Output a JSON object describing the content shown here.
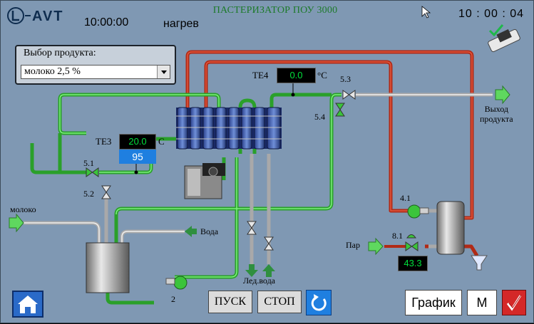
{
  "header": {
    "brand": "L-AVT",
    "title": "ПАСТЕРИЗАТОР ПОУ 3000",
    "time": "10:00:00",
    "mode": "нагрев",
    "clock": "10 : 00 : 04"
  },
  "product": {
    "label": "Выбор продукта:",
    "selected": "молоко 2,5 %"
  },
  "sensors": {
    "te4": {
      "label": "TE4",
      "value": "0.0",
      "unit": "°C"
    },
    "te3": {
      "label": "TE3",
      "value": "20.0",
      "unit": "C",
      "setpoint": "95"
    },
    "steam_value": "43.3"
  },
  "valves": {
    "v51": "5.1",
    "v52": "5.2",
    "v53": "5.3",
    "v54": "5.4",
    "pump41": "4.1",
    "v81": "8.1",
    "pump2": "2"
  },
  "labels": {
    "milk_in": "молоко",
    "water": "Вода",
    "ice_water": "Лед.вода",
    "steam": "Пар",
    "product_out": "Выход\nпродукта"
  },
  "buttons": {
    "start": "ПУСК",
    "stop": "СТОП",
    "graph": "График",
    "m": "M"
  },
  "colors": {
    "background": "#7f98b3",
    "product_pipe": "#3bc43b",
    "hot_pipe": "#c8321e",
    "cold_pipe": "#d9d9d9",
    "display_text": "#00e03c",
    "setpoint_bg": "#1f7fe0"
  }
}
